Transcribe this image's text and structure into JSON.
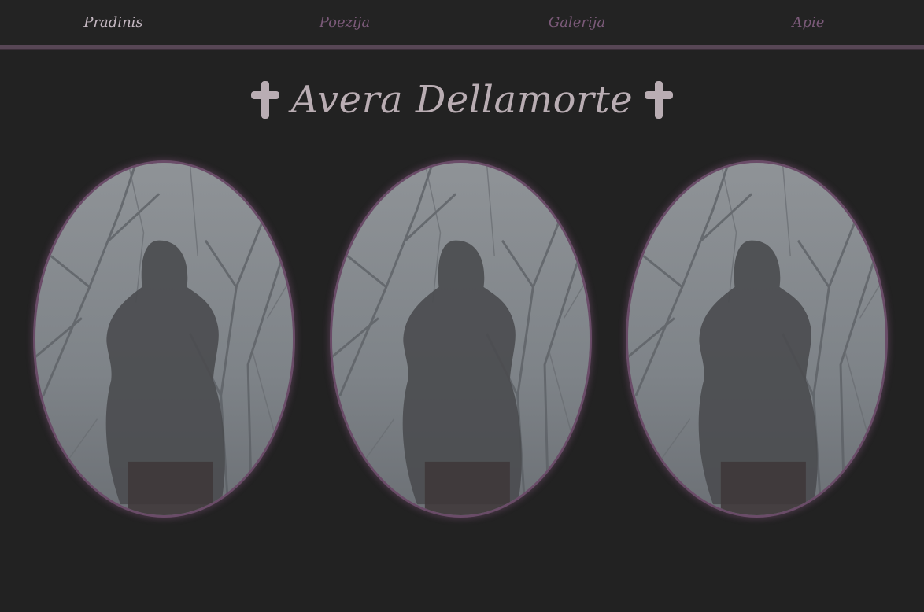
{
  "nav": {
    "items": [
      {
        "label": "Pradinis",
        "active": true
      },
      {
        "label": "Poezija",
        "active": false
      },
      {
        "label": "Galerija",
        "active": false
      },
      {
        "label": "Apie",
        "active": false
      }
    ]
  },
  "header": {
    "title": "Avera Dellamorte",
    "ornament": "cross-icon"
  },
  "gallery": {
    "photos": [
      {
        "subject": "hooded-figure-in-forest"
      },
      {
        "subject": "hooded-figure-in-forest"
      },
      {
        "subject": "hooded-figure-in-forest"
      }
    ]
  },
  "colors": {
    "background": "#222222",
    "accent": "#574655",
    "nav_inactive": "#7b5a79",
    "nav_active": "#c5b8c2",
    "title": "#b9adb3"
  }
}
